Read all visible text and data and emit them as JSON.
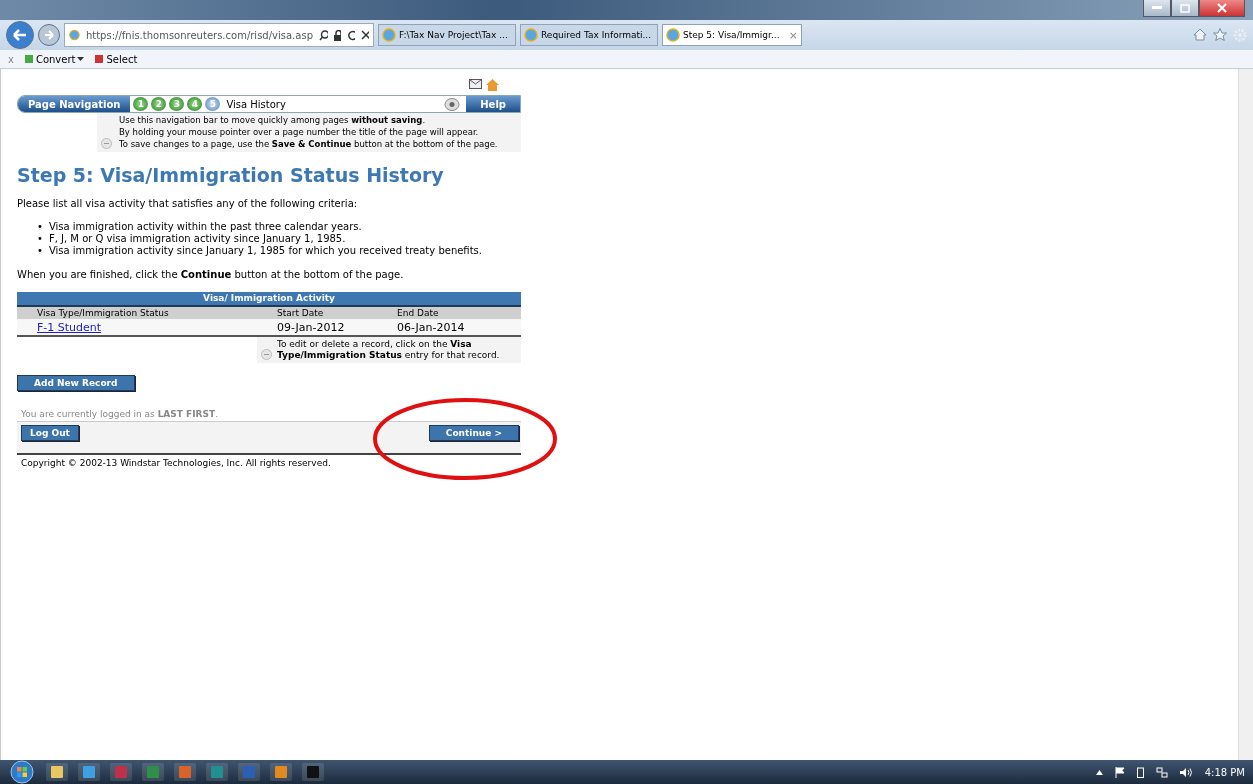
{
  "browser": {
    "address": "https://fnis.thomsonreuters.com/risd/visa.asp",
    "tabs": [
      {
        "label": "F:\\Tax Nav Project\\Tax ...",
        "selected": false
      },
      {
        "label": "Required Tax Informati...",
        "selected": false
      },
      {
        "label": "Step 5: Visa/Immigr...",
        "selected": true
      }
    ],
    "tab_close": "×",
    "toolbar_close": "x",
    "toolbar_items": [
      "Convert",
      "Select"
    ]
  },
  "page_nav": {
    "label": "Page Navigation",
    "steps": [
      {
        "number": "1",
        "selected": false
      },
      {
        "number": "2",
        "selected": false
      },
      {
        "number": "3",
        "selected": false
      },
      {
        "number": "4",
        "selected": false
      },
      {
        "number": "5",
        "selected": true
      }
    ],
    "current_page": "Visa History",
    "help": "Help",
    "info": [
      "Use this navigation bar to move quickly among pages **without saving**.",
      "By holding your mouse pointer over a page number the title of the page will appear.",
      "To save changes to a page, use the **Save & Continue** button at the bottom of the page."
    ]
  },
  "heading": "Step 5: Visa/Immigration Status History",
  "intro": "Please list all visa activity that satisfies any of the following criteria:",
  "criteria": [
    {
      "bullet": "•",
      "text": "Visa immigration activity within the past three calendar years."
    },
    {
      "bullet": "•",
      "text": "F, J, M or Q visa immigration activity since January 1, 1985."
    },
    {
      "bullet": "•",
      "text": "Visa immigration activity since January 1, 1985 for which you received treaty benefits."
    }
  ],
  "finish_note": "When you are finished, click the **Continue** button at the bottom of the page.",
  "table": {
    "title": "Visa/ Immigration Activity",
    "columns": [
      "Visa Type/Immigration Status",
      "Start Date",
      "End Date"
    ],
    "rows": [
      {
        "status": "F-1 Student",
        "start": "09-Jan-2012",
        "end": "06-Jan-2014"
      }
    ],
    "note": "To edit or delete a record, click on the **Visa Type/Immigration Status** entry for that record."
  },
  "add_button": "Add New Record",
  "logged_in": "You are currently logged in as **LAST FIRST**.",
  "logout_button": "Log Out",
  "continue_button": "Continue >",
  "copyright": "Copyright © 2002-13 Windstar Technologies, Inc. All rights reserved.",
  "taskbar": {
    "apps": [
      {
        "kind": "folder"
      },
      {
        "kind": "browser"
      },
      {
        "kind": "access"
      },
      {
        "kind": "excel"
      },
      {
        "kind": "powerpoint"
      },
      {
        "kind": "publisher"
      },
      {
        "kind": "word"
      },
      {
        "kind": "media"
      },
      {
        "kind": "terminal"
      }
    ],
    "clock": "4:18 PM"
  }
}
